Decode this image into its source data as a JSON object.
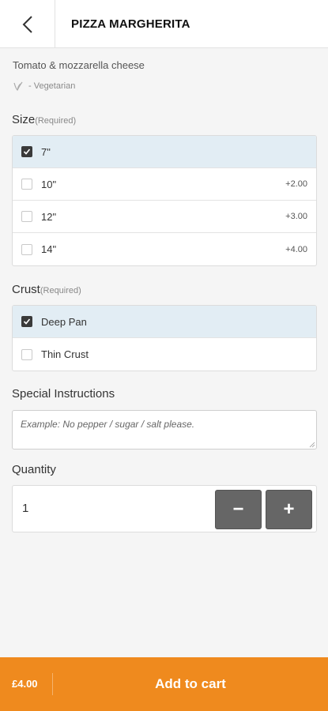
{
  "header": {
    "title": "PIZZA MARGHERITA",
    "back_icon": "chevron-left-icon"
  },
  "item": {
    "description": "Tomato & mozzarella cheese",
    "diet_label": "- Vegetarian",
    "diet_icon": "vegetarian-leaf-icon"
  },
  "size": {
    "heading": "Size",
    "required": "(Required)",
    "options": [
      {
        "label": "7\"",
        "price": "",
        "selected": true
      },
      {
        "label": "10\"",
        "price": "+2.00",
        "selected": false
      },
      {
        "label": "12\"",
        "price": "+3.00",
        "selected": false
      },
      {
        "label": "14\"",
        "price": "+4.00",
        "selected": false
      }
    ]
  },
  "crust": {
    "heading": "Crust",
    "required": "(Required)",
    "options": [
      {
        "label": "Deep Pan",
        "selected": true
      },
      {
        "label": "Thin Crust",
        "selected": false
      }
    ]
  },
  "instructions": {
    "heading": "Special Instructions",
    "placeholder": "Example: No pepper / sugar / salt please."
  },
  "quantity": {
    "heading": "Quantity",
    "value": "1",
    "minus_label": "−",
    "plus_label": "+"
  },
  "cart": {
    "price": "£4.00",
    "button_label": "Add to cart",
    "accent_color": "#ef8a1e"
  },
  "colors": {
    "selected_row": "#e2edf4",
    "button_gray": "#666666"
  }
}
